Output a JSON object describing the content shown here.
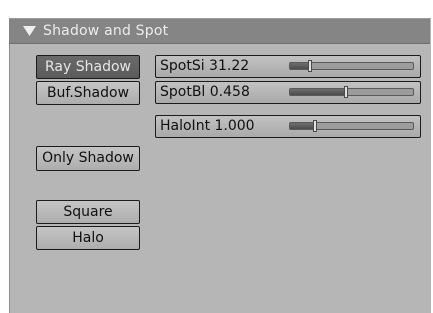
{
  "panel": {
    "title": "Shadow and Spot",
    "collapse_icon": "triangle-down-icon"
  },
  "buttons": {
    "ray_shadow": "Ray Shadow",
    "buf_shadow": "Buf.Shadow",
    "only_shadow": "Only Shadow",
    "square": "Square",
    "halo": "Halo"
  },
  "sliders": {
    "spot_si": {
      "label": "SpotSi 31.22",
      "value": 0.16
    },
    "spot_bl": {
      "label": "SpotBl 0.458",
      "value": 0.458
    },
    "halo_int": {
      "label": "HaloInt 1.000",
      "value": 0.2
    }
  }
}
